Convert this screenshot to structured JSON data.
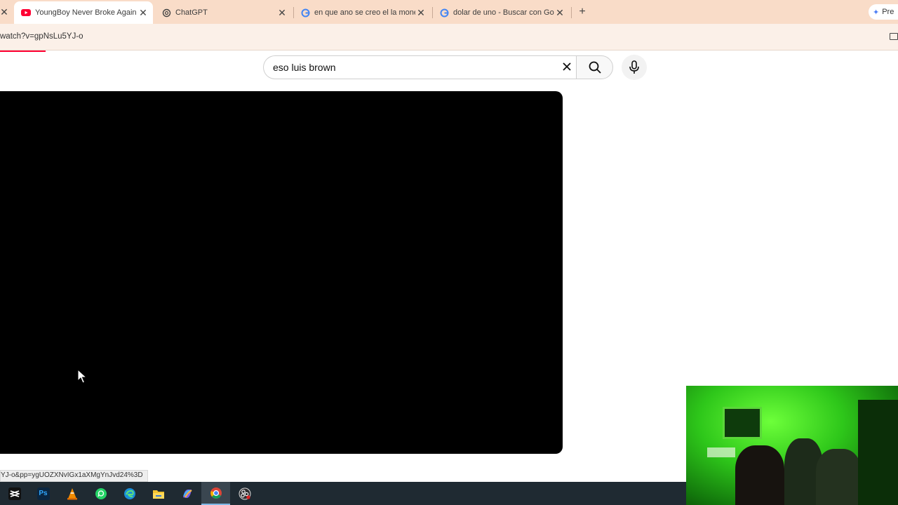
{
  "browser": {
    "tabs": [
      {
        "title": "YoungBoy Never Broke Again -",
        "favicon": "youtube-icon",
        "active": true
      },
      {
        "title": "ChatGPT",
        "favicon": "chatgpt-icon",
        "active": false
      },
      {
        "title": "en que ano se creo el la moneda",
        "favicon": "google-icon",
        "active": false
      },
      {
        "title": "dolar de uno - Buscar con Google",
        "favicon": "google-icon",
        "active": false
      }
    ],
    "new_tab_label": "+",
    "close_glyph": "✕",
    "right_pill_label": "Pre",
    "address": "watch?v=gpNsLu5YJ-o"
  },
  "youtube": {
    "search_value": "eso luis brown",
    "accent": "#ff0033"
  },
  "status_bar": {
    "link": "YJ-o&pp=ygUOZXNvIGx1aXMgYnJvd24%3D"
  },
  "taskbar": {
    "items": [
      {
        "name": "capcut-icon",
        "label": ""
      },
      {
        "name": "photoshop-icon",
        "label": "Ps"
      },
      {
        "name": "vlc-icon",
        "label": ""
      },
      {
        "name": "whatsapp-icon",
        "label": ""
      },
      {
        "name": "edge-icon",
        "label": ""
      },
      {
        "name": "file-explorer-icon",
        "label": ""
      },
      {
        "name": "copilot-icon",
        "label": ""
      },
      {
        "name": "chrome-icon",
        "label": ""
      },
      {
        "name": "obs-icon",
        "label": ""
      }
    ]
  }
}
